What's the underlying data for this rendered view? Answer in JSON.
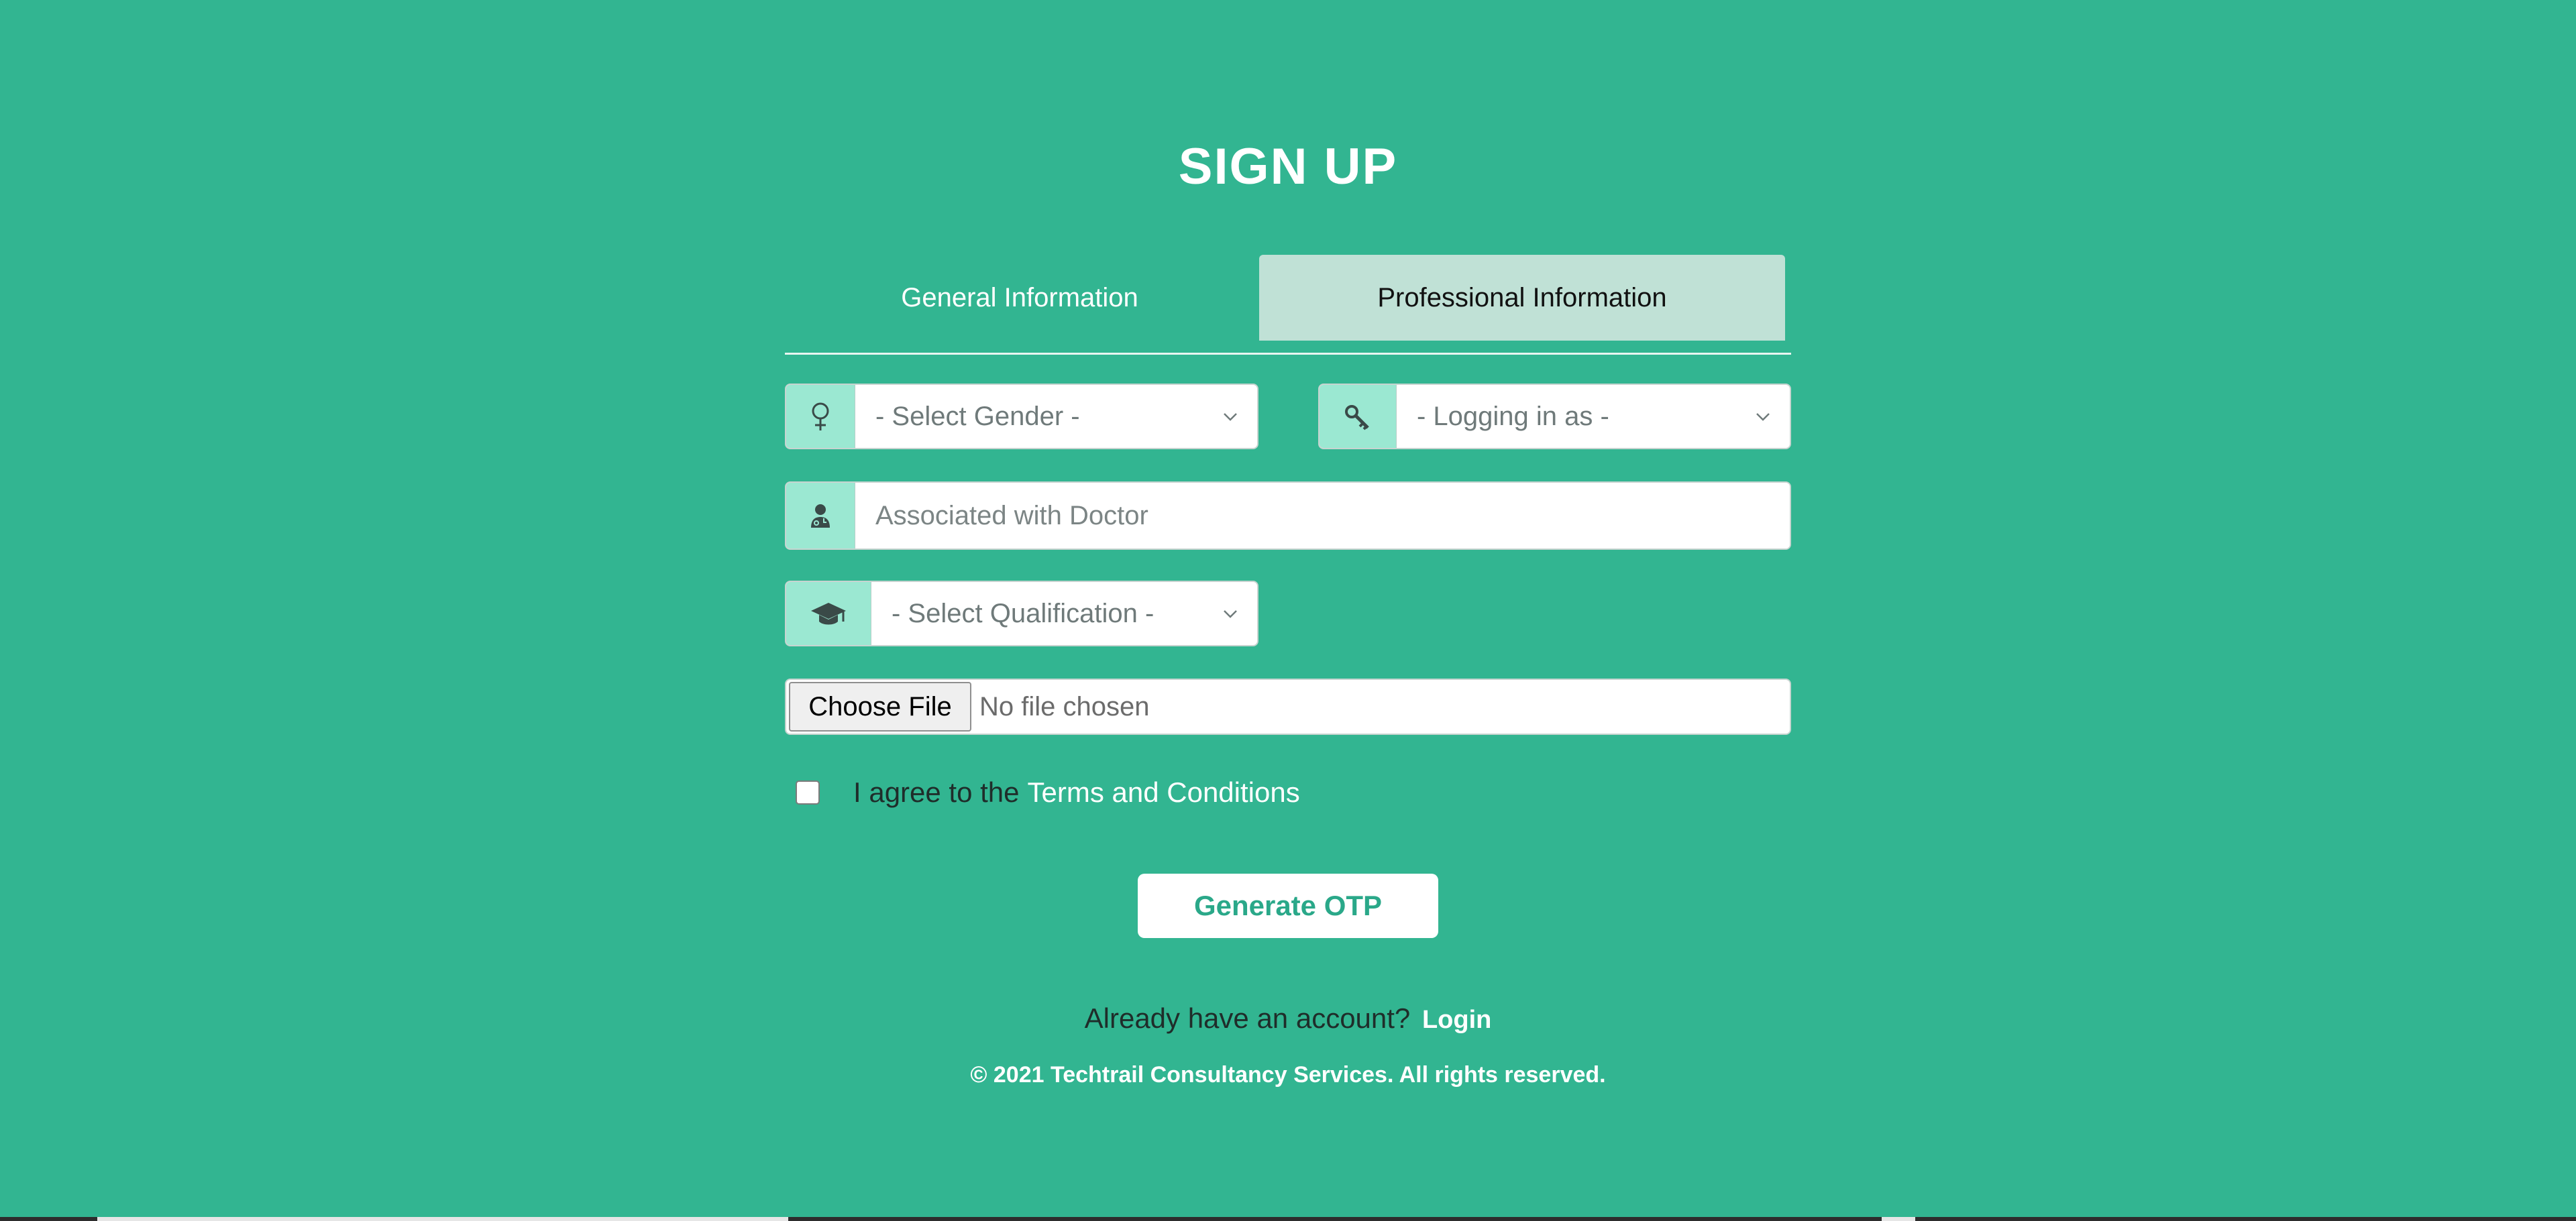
{
  "page": {
    "title": "SIGN UP"
  },
  "tabs": [
    {
      "label": "General Information",
      "active": false
    },
    {
      "label": "Professional Information",
      "active": true
    }
  ],
  "form": {
    "gender": {
      "value": "- Select Gender -",
      "icon": "female-icon"
    },
    "role": {
      "value": "- Logging in as -",
      "icon": "key-icon"
    },
    "doctor": {
      "placeholder": "Associated with Doctor",
      "icon": "doctor-icon"
    },
    "qualification": {
      "value": "- Select Qualification -",
      "icon": "graduation-cap-icon"
    },
    "file": {
      "button_label": "Choose File",
      "status": "No file chosen"
    },
    "terms": {
      "prefix": "I agree to the",
      "link": "Terms and Conditions"
    },
    "submit_label": "Generate OTP"
  },
  "footer": {
    "login_prompt": "Already have an account?",
    "login_link": "Login",
    "copyright": "© 2021 Techtrail Consultancy Services. All rights reserved."
  },
  "colors": {
    "background": "#32b591",
    "active_tab": "#c0e1d6",
    "addon": "#9be8d2",
    "button_text": "#2aa889"
  }
}
